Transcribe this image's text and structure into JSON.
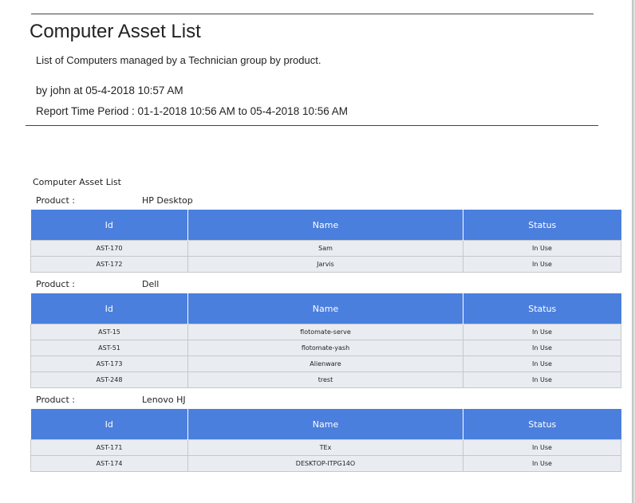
{
  "report": {
    "title": "Computer Asset List",
    "description": "List of Computers managed by a Technician group by product.",
    "byline": "by john at 05-4-2018 10:57 AM",
    "period": "Report Time Period : 01-1-2018 10:56 AM to 05-4-2018 10:56 AM",
    "section_title": "Computer Asset List"
  },
  "columns": [
    "Id",
    "Name",
    "Status"
  ],
  "product_label": "Product :",
  "groups": [
    {
      "product": "HP Desktop",
      "rows": [
        {
          "id": "AST-170",
          "name": "Sam",
          "status": "In Use"
        },
        {
          "id": "AST-172",
          "name": "Jarvis",
          "status": "In Use"
        }
      ]
    },
    {
      "product": "Dell",
      "rows": [
        {
          "id": "AST-15",
          "name": "flotomate-serve",
          "status": "In Use"
        },
        {
          "id": "AST-51",
          "name": "flotomate-yash",
          "status": "In Use"
        },
        {
          "id": "AST-173",
          "name": "Alienware",
          "status": "In Use"
        },
        {
          "id": "AST-248",
          "name": "trest",
          "status": "In Use"
        }
      ]
    },
    {
      "product": "Lenovo HJ",
      "rows": [
        {
          "id": "AST-171",
          "name": "TEx",
          "status": "In Use"
        },
        {
          "id": "AST-174",
          "name": "DESKTOP-ITPG14O",
          "status": "In Use"
        }
      ]
    }
  ]
}
